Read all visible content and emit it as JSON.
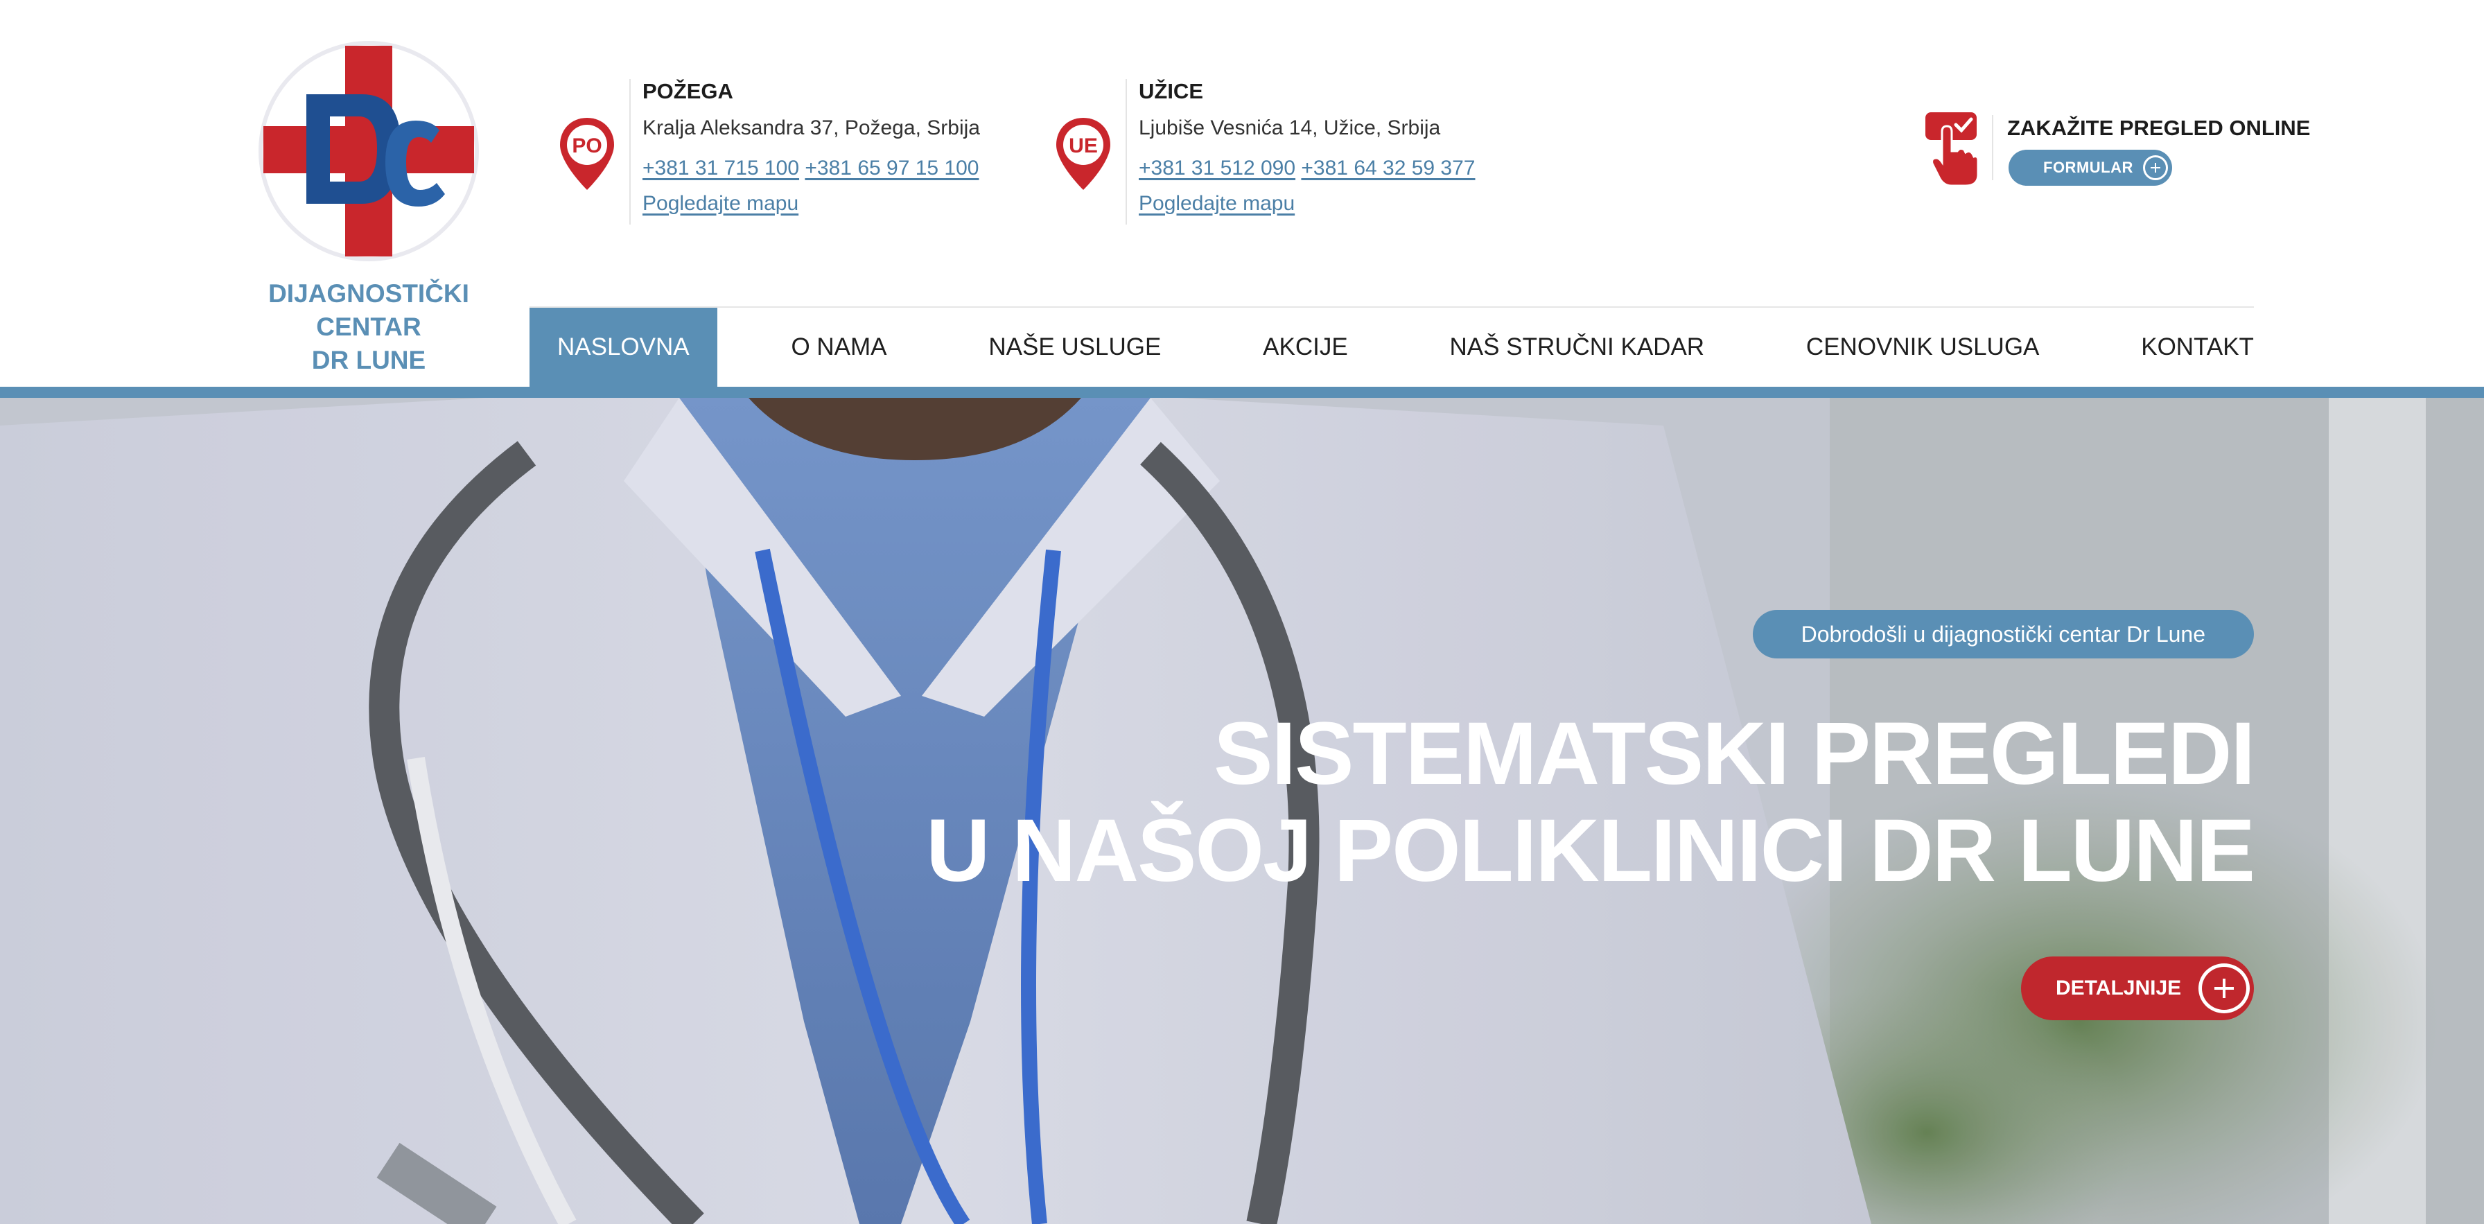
{
  "colors": {
    "brand_blue": "#5a8fb5",
    "brand_red": "#c0272d",
    "logo_navy": "#1f4f91",
    "text_dark": "#1c1c1c",
    "link": "#4b7fa6"
  },
  "logo": {
    "monogram": "DC",
    "line1": "DIJAGNOSTIČKI CENTAR",
    "line2": "DR LUNE"
  },
  "locations": [
    {
      "badge": "PO",
      "city": "POŽEGA",
      "address": "Kralja Aleksandra 37, Požega, Srbija",
      "phone1": "+381 31 715 100",
      "phone2": "+381 65 97 15 100",
      "map_link": "Pogledajte mapu",
      "icon": "map-pin-icon"
    },
    {
      "badge": "UE",
      "city": "UŽICE",
      "address": "Ljubiše Vesnića 14, Užice, Srbija",
      "phone1": "+381 31 512 090",
      "phone2": "+381 64 32 59 377",
      "map_link": "Pogledajte mapu",
      "icon": "map-pin-icon"
    }
  ],
  "booking": {
    "icon": "touch-hand-icon",
    "title": "ZAKAŽITE PREGLED ONLINE",
    "button_label": "FORMULAR"
  },
  "nav": {
    "items": [
      {
        "label": "NASLOVNA",
        "active": true
      },
      {
        "label": "O NAMA",
        "active": false
      },
      {
        "label": "NAŠE USLUGE",
        "active": false
      },
      {
        "label": "AKCIJE",
        "active": false
      },
      {
        "label": "NAŠ STRUČNI KADAR",
        "active": false
      },
      {
        "label": "CENOVNIK USLUGA",
        "active": false
      },
      {
        "label": "KONTAKT",
        "active": false
      }
    ]
  },
  "hero": {
    "badge": "Dobrodošli u dijagnostički centar Dr Lune",
    "title_line1": "SISTEMATSKI PREGLEDI",
    "title_line2": "U NAŠOJ POLIKLINICI DR LUNE",
    "button_label": "DETALJNIJE"
  }
}
